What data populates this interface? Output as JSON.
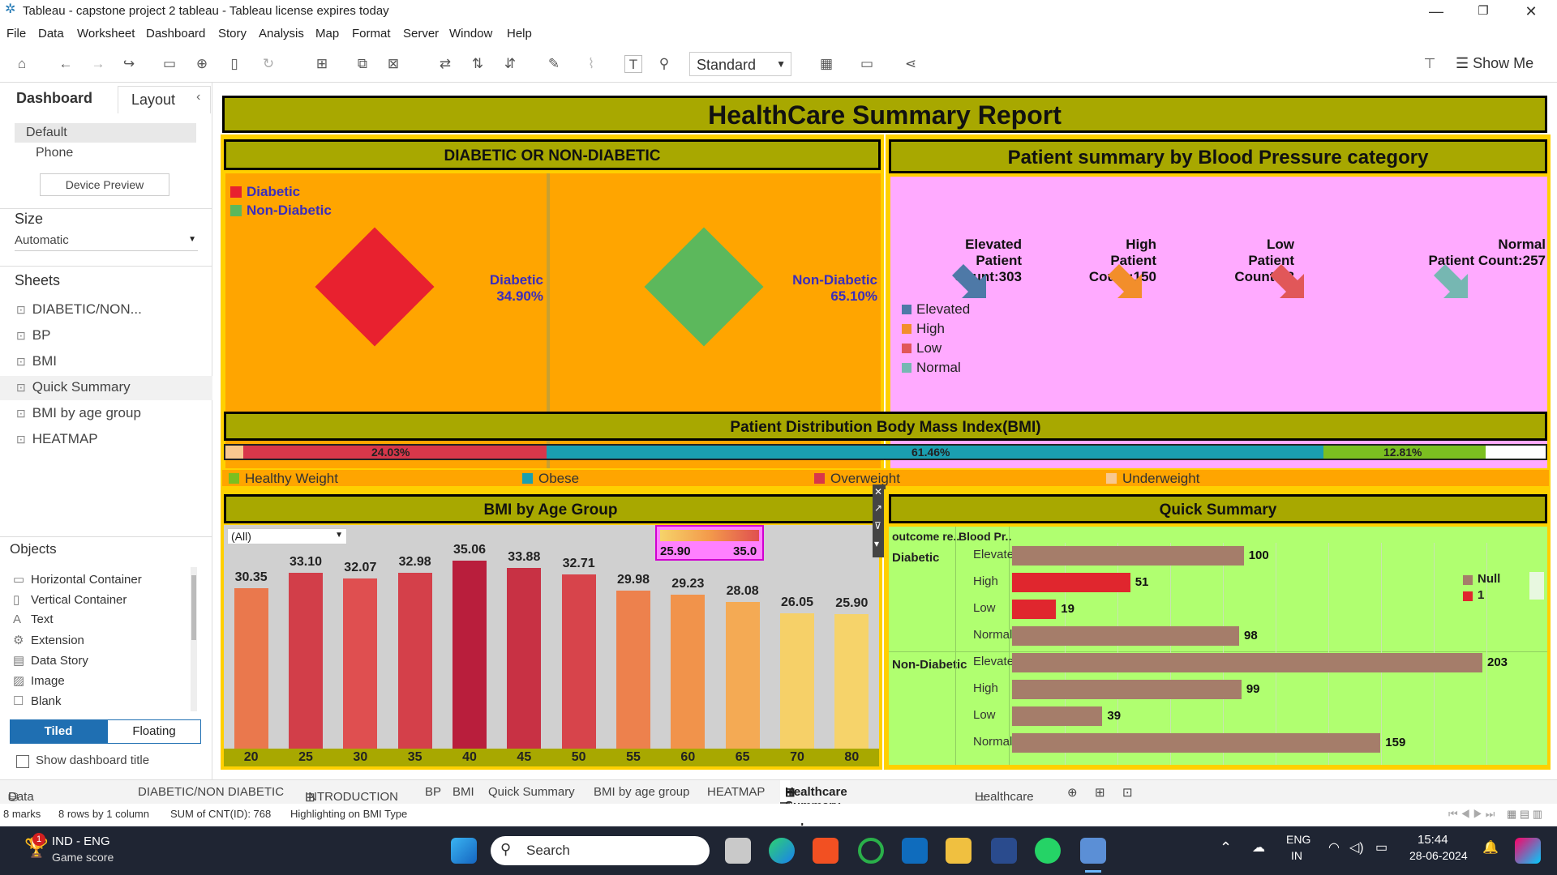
{
  "window": {
    "title": "Tableau - capstone project 2 tableau - Tableau license expires today"
  },
  "menu": [
    "File",
    "Data",
    "Worksheet",
    "Dashboard",
    "Story",
    "Analysis",
    "Map",
    "Format",
    "Server",
    "Window",
    "Help"
  ],
  "toolbar": {
    "fit": "Standard",
    "show_me": "Show Me"
  },
  "left": {
    "tab_dashboard": "Dashboard",
    "tab_layout": "Layout",
    "device_default": "Default",
    "device_phone": "Phone",
    "device_preview": "Device Preview",
    "size_title": "Size",
    "size_value": "Automatic",
    "sheets_title": "Sheets",
    "sheets": [
      "DIABETIC/NON...",
      "BP",
      "BMI",
      "Quick Summary",
      "BMI by age group",
      "HEATMAP"
    ],
    "objects_title": "Objects",
    "objects": [
      "Horizontal Container",
      "Vertical Container",
      "Text",
      "Extension",
      "Data Story",
      "Image",
      "Blank"
    ],
    "tiled": "Tiled",
    "floating": "Floating",
    "show_title": "Show dashboard title"
  },
  "dashboard": {
    "title": "HealthCare Summary Report",
    "diab": {
      "title": "DIABETIC  OR NON-DIABETIC",
      "legend": [
        "Diabetic",
        "Non-Diabetic"
      ],
      "left_name": "Diabetic",
      "left_pct": "34.90%",
      "right_name": "Non-Diabetic",
      "right_pct": "65.10%",
      "colors": {
        "diabetic": "#e8212f",
        "non_diabetic": "#5cb85c",
        "bg": "#ffa500"
      }
    },
    "bp": {
      "title": "Patient summary by Blood Pressure category",
      "items": [
        {
          "name": "Elevated",
          "count": "Patient Count:303",
          "color": "#4e79a7"
        },
        {
          "name": "High",
          "count": "Patient Count:150",
          "color": "#f28e2b"
        },
        {
          "name": "Low",
          "count": "Patient Count:58",
          "color": "#e15759"
        },
        {
          "name": "Normal",
          "count": "Patient Count:257",
          "color": "#76b7b2"
        }
      ],
      "legend": [
        "Elevated",
        "High",
        "Low",
        "Normal"
      ]
    },
    "bmi": {
      "title": "Patient Distribution Body Mass Index(BMI)",
      "seg_labels": [
        "24.03%",
        "61.46%",
        "12.81%"
      ],
      "legend": [
        "Healthy Weight",
        "Obese",
        "Overweight",
        "Underweight"
      ]
    },
    "age": {
      "title": "BMI by Age Group",
      "filter": "(All)",
      "range_min": "25.90",
      "range_max": "35.0"
    },
    "quick": {
      "title": "Quick Summary",
      "col1": "outcome re..",
      "col2": "Blood Pr..",
      "groups": [
        "Diabetic",
        "Non-Diabetic"
      ],
      "rows": [
        {
          "bp": "Elevated",
          "val": "100"
        },
        {
          "bp": "High",
          "val": "51"
        },
        {
          "bp": "Low",
          "val": "19"
        },
        {
          "bp": "Normal",
          "val": "98"
        },
        {
          "bp": "Elevated",
          "val": "203"
        },
        {
          "bp": "High",
          "val": "99"
        },
        {
          "bp": "Low",
          "val": "39"
        },
        {
          "bp": "Normal",
          "val": "159"
        }
      ],
      "legend": [
        "Null",
        "1"
      ]
    }
  },
  "chart_data": [
    {
      "type": "bar",
      "title": "BMI by Age Group",
      "categories": [
        "20",
        "25",
        "30",
        "35",
        "40",
        "45",
        "50",
        "55",
        "60",
        "65",
        "70",
        "80"
      ],
      "values": [
        30.35,
        33.1,
        32.07,
        32.98,
        35.06,
        33.88,
        32.71,
        29.98,
        29.23,
        28.08,
        26.05,
        25.9
      ],
      "ylim": [
        0,
        36
      ]
    },
    {
      "type": "bar",
      "title": "Quick Summary",
      "categories": [
        "Diabetic Elevated",
        "Diabetic High",
        "Diabetic Low",
        "Diabetic Normal",
        "Non-Diabetic Elevated",
        "Non-Diabetic High",
        "Non-Diabetic Low",
        "Non-Diabetic Normal"
      ],
      "values": [
        100,
        51,
        19,
        98,
        203,
        99,
        39,
        159
      ]
    },
    {
      "type": "bar",
      "title": "Patient Distribution Body Mass Index(BMI)",
      "categories": [
        "Underweight",
        "Overweight",
        "Obese",
        "Healthy Weight"
      ],
      "values": [
        1.7,
        24.03,
        61.46,
        12.81
      ]
    }
  ],
  "bottom_tabs": [
    "Data Source",
    "DIABETIC/NON DIABETIC",
    "INTRODUCTION",
    "BP",
    "BMI",
    "Quick Summary",
    "BMI by age group",
    "HEATMAP",
    "Healthcare Summary Report",
    "Healthcare"
  ],
  "status": {
    "marks": "8 marks",
    "rows": "8 rows by 1 column",
    "sum": "SUM of CNT(ID): 768",
    "highlight": "Highlighting on BMI Type"
  },
  "taskbar": {
    "weather1": "IND - ENG",
    "weather2": "Game score",
    "search": "Search",
    "lang1": "ENG",
    "lang2": "IN",
    "time": "15:44",
    "date": "28-06-2024"
  }
}
